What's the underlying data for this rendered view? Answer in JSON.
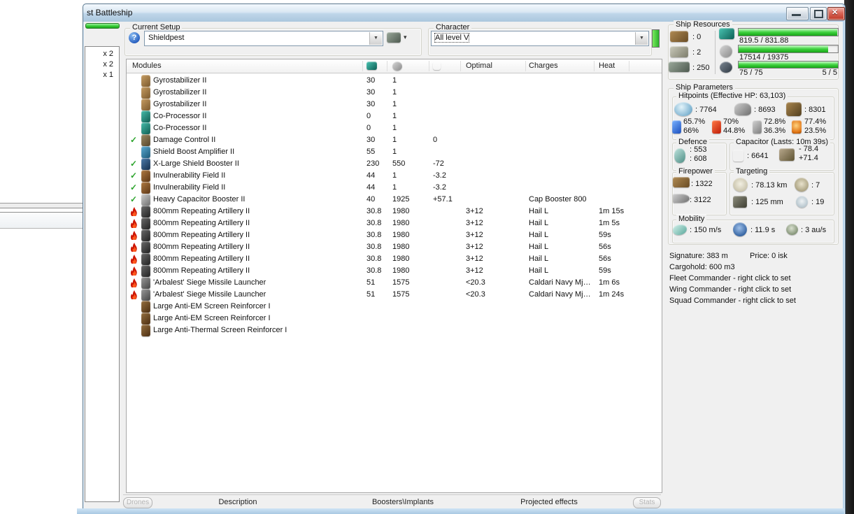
{
  "window": {
    "title": "st Battleship",
    "controls": {
      "minimize": "minimize",
      "maximize": "maximize",
      "close": "r"
    }
  },
  "left_panel": {
    "items": [
      "x 2",
      "x 2",
      "x 1"
    ]
  },
  "setup": {
    "group_label": "Current Setup",
    "help_glyph": "?",
    "value": "Shieldpest",
    "tools_caret": "▾"
  },
  "character": {
    "group_label": "Character",
    "value": "All level V"
  },
  "ship_resources": {
    "label": "Ship Resources",
    "turret_hardpoints": ": 0",
    "launcher_hardpoints": ": 2",
    "calibration": ": 250",
    "cpu": {
      "text": "819.5 / 831.88",
      "fill": 99
    },
    "powergrid": {
      "text": "17514 / 19375",
      "fill": 90
    },
    "dronebay": {
      "text": "75 / 75",
      "right_text": "5 / 5",
      "fill": 100
    }
  },
  "modules": {
    "header": {
      "name": "Modules",
      "optimal": "Optimal",
      "charges": "Charges",
      "heat": "Heat"
    },
    "rows": [
      {
        "state": "",
        "icon": "gyro",
        "name": "Gyrostabilizer II",
        "cpu": "30",
        "pg": "1",
        "cap": "",
        "optimal": "",
        "charges": "",
        "heat": ""
      },
      {
        "state": "",
        "icon": "gyro",
        "name": "Gyrostabilizer II",
        "cpu": "30",
        "pg": "1",
        "cap": "",
        "optimal": "",
        "charges": "",
        "heat": ""
      },
      {
        "state": "",
        "icon": "gyro",
        "name": "Gyrostabilizer II",
        "cpu": "30",
        "pg": "1",
        "cap": "",
        "optimal": "",
        "charges": "",
        "heat": ""
      },
      {
        "state": "",
        "icon": "coproc",
        "name": "Co-Processor II",
        "cpu": "0",
        "pg": "1",
        "cap": "",
        "optimal": "",
        "charges": "",
        "heat": ""
      },
      {
        "state": "",
        "icon": "coproc",
        "name": "Co-Processor II",
        "cpu": "0",
        "pg": "1",
        "cap": "",
        "optimal": "",
        "charges": "",
        "heat": ""
      },
      {
        "state": "check",
        "icon": "dc",
        "name": "Damage Control II",
        "cpu": "30",
        "pg": "1",
        "cap": "0",
        "optimal": "",
        "charges": "",
        "heat": ""
      },
      {
        "state": "",
        "icon": "sba",
        "name": "Shield Boost Amplifier II",
        "cpu": "55",
        "pg": "1",
        "cap": "",
        "optimal": "",
        "charges": "",
        "heat": ""
      },
      {
        "state": "check",
        "icon": "xlsb",
        "name": "X-Large Shield Booster II",
        "cpu": "230",
        "pg": "550",
        "cap": "-72",
        "optimal": "",
        "charges": "",
        "heat": ""
      },
      {
        "state": "check",
        "icon": "invul",
        "name": "Invulnerability Field II",
        "cpu": "44",
        "pg": "1",
        "cap": "-3.2",
        "optimal": "",
        "charges": "",
        "heat": ""
      },
      {
        "state": "check",
        "icon": "invul",
        "name": "Invulnerability Field II",
        "cpu": "44",
        "pg": "1",
        "cap": "-3.2",
        "optimal": "",
        "charges": "",
        "heat": ""
      },
      {
        "state": "check",
        "icon": "hcb",
        "name": "Heavy Capacitor Booster II",
        "cpu": "40",
        "pg": "1925",
        "cap": "+57.1",
        "optimal": "",
        "charges": "Cap Booster 800",
        "heat": ""
      },
      {
        "state": "flame",
        "icon": "arty",
        "name": "800mm Repeating Artillery II",
        "cpu": "30.8",
        "pg": "1980",
        "cap": "",
        "optimal": "3+12",
        "charges": "Hail L",
        "heat": "1m 15s"
      },
      {
        "state": "flame",
        "icon": "arty",
        "name": "800mm Repeating Artillery II",
        "cpu": "30.8",
        "pg": "1980",
        "cap": "",
        "optimal": "3+12",
        "charges": "Hail L",
        "heat": "1m 5s"
      },
      {
        "state": "flame",
        "icon": "arty",
        "name": "800mm Repeating Artillery II",
        "cpu": "30.8",
        "pg": "1980",
        "cap": "",
        "optimal": "3+12",
        "charges": "Hail L",
        "heat": "59s"
      },
      {
        "state": "flame",
        "icon": "arty",
        "name": "800mm Repeating Artillery II",
        "cpu": "30.8",
        "pg": "1980",
        "cap": "",
        "optimal": "3+12",
        "charges": "Hail L",
        "heat": "56s"
      },
      {
        "state": "flame",
        "icon": "arty",
        "name": "800mm Repeating Artillery II",
        "cpu": "30.8",
        "pg": "1980",
        "cap": "",
        "optimal": "3+12",
        "charges": "Hail L",
        "heat": "56s"
      },
      {
        "state": "flame",
        "icon": "arty",
        "name": "800mm Repeating Artillery II",
        "cpu": "30.8",
        "pg": "1980",
        "cap": "",
        "optimal": "3+12",
        "charges": "Hail L",
        "heat": "59s"
      },
      {
        "state": "flame",
        "icon": "launcher",
        "name": "'Arbalest' Siege Missile Launcher",
        "cpu": "51",
        "pg": "1575",
        "cap": "",
        "optimal": "<20.3",
        "charges": "Caldari Navy Mjo...",
        "heat": "1m 6s"
      },
      {
        "state": "flame",
        "icon": "launcher",
        "name": "'Arbalest' Siege Missile Launcher",
        "cpu": "51",
        "pg": "1575",
        "cap": "",
        "optimal": "<20.3",
        "charges": "Caldari Navy Mjo...",
        "heat": "1m 24s"
      },
      {
        "state": "",
        "icon": "rig",
        "name": "Large Anti-EM Screen Reinforcer I",
        "cpu": "",
        "pg": "",
        "cap": "",
        "optimal": "",
        "charges": "",
        "heat": ""
      },
      {
        "state": "",
        "icon": "rig",
        "name": "Large Anti-EM Screen Reinforcer I",
        "cpu": "",
        "pg": "",
        "cap": "",
        "optimal": "",
        "charges": "",
        "heat": ""
      },
      {
        "state": "",
        "icon": "rig",
        "name": "Large Anti-Thermal Screen Reinforcer I",
        "cpu": "",
        "pg": "",
        "cap": "",
        "optimal": "",
        "charges": "",
        "heat": ""
      }
    ]
  },
  "ship_parameters": {
    "label": "Ship Parameters",
    "hitpoints": {
      "label": "Hitpoints (Effective HP: 63,103)",
      "shield": ": 7764",
      "armor": ": 8693",
      "hull": ": 8301",
      "resists": [
        {
          "type": "em",
          "a": "65.7%",
          "b": "66%"
        },
        {
          "type": "thermal",
          "a": "70%",
          "b": "44.8%"
        },
        {
          "type": "kinetic",
          "a": "72.8%",
          "b": "36.3%"
        },
        {
          "type": "explosive",
          "a": "77.4%",
          "b": "23.5%"
        }
      ]
    },
    "defence": {
      "label": "Defence",
      "v1": ": 553",
      "v2": ": 608"
    },
    "capacitor": {
      "label": "Capacitor (Lasts: 10m 39s)",
      "amount": ": 6641",
      "delta_neg": "- 78.4",
      "delta_pos": "+71.4"
    },
    "firepower": {
      "label": "Firepower",
      "volley": ": 1322",
      "dps": ": 3122"
    },
    "targeting": {
      "label": "Targeting",
      "range": ": 78.13 km",
      "sensor": ": 7",
      "sig_res": ": 125 mm",
      "max_locks": ": 19"
    },
    "mobility": {
      "label": "Mobility",
      "speed": ": 150 m/s",
      "align": ": 11.9 s",
      "warp": ": 3 au/s"
    },
    "info": {
      "signature": "Signature: 383 m",
      "price": "Price: 0 isk",
      "cargohold": "Cargohold: 600 m3",
      "fleet": "Fleet Commander - right click to set",
      "wing": "Wing Commander - right click to set",
      "squad": "Squad Commander - right click to set"
    }
  },
  "bottom_tabs": {
    "drones": "Drones",
    "description": "Description",
    "boosters": "Boosters\\Implants",
    "projected": "Projected effects",
    "stats": "Stats"
  },
  "colors": {
    "bar_green": "#3fd23f",
    "titlebar_blue": "#b9d4ea",
    "close_red": "#bf3a28",
    "check_green": "#2ca42c",
    "flame_red": "#cc1605"
  }
}
